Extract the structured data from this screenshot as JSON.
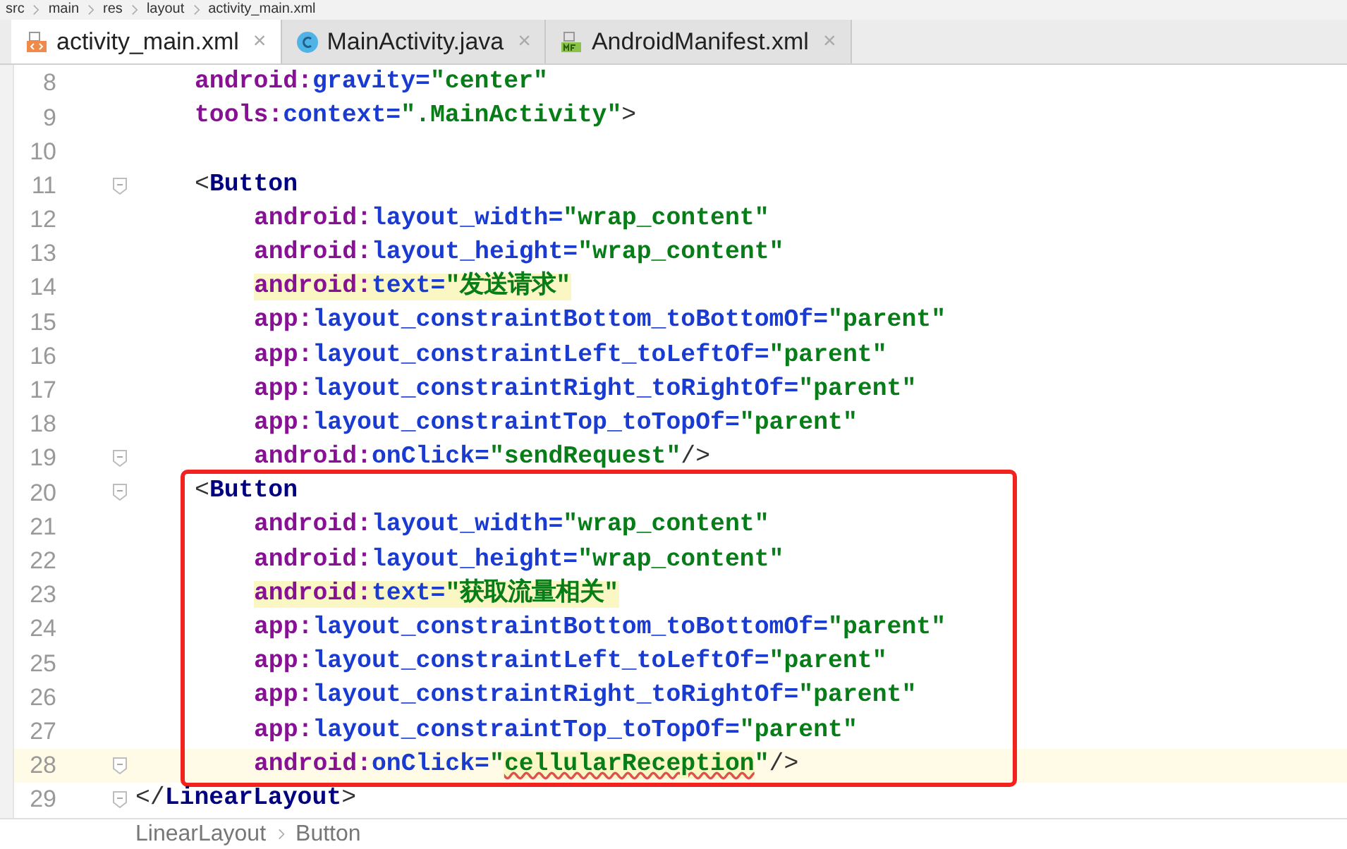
{
  "breadcrumb": [
    "src",
    "main",
    "res",
    "layout",
    "activity_main.xml"
  ],
  "tabs": [
    {
      "label": "activity_main.xml",
      "kind": "xml",
      "selected": true,
      "close": "×"
    },
    {
      "label": "MainActivity.java",
      "kind": "class",
      "selected": false,
      "close": "×"
    },
    {
      "label": "AndroidManifest.xml",
      "kind": "manifest",
      "selected": false,
      "close": "×"
    }
  ],
  "editor": {
    "blocks": [
      {
        "lines": [
          {
            "number": "8",
            "kind": "outer-attr",
            "tokens": [
              {
                "kind": "ns",
                "text": "android:"
              },
              {
                "kind": "attr",
                "text": "gravity="
              },
              {
                "kind": "str",
                "text": "\"center\""
              }
            ]
          },
          {
            "number": "9",
            "kind": "outer-attr",
            "tokens": [
              {
                "kind": "ns",
                "text": "tools:"
              },
              {
                "kind": "attr",
                "text": "context="
              },
              {
                "kind": "str",
                "text": "\".MainActivity\""
              },
              {
                "kind": "punct",
                "text": ">"
              }
            ]
          },
          {
            "number": "10"
          },
          {
            "number": "11",
            "kind": "element",
            "fold": true,
            "tokens": [
              {
                "kind": "punct",
                "text": "<"
              },
              {
                "kind": "tag",
                "text": "Button"
              }
            ]
          },
          {
            "number": "12",
            "kind": "attr",
            "tokens": [
              {
                "kind": "ns",
                "text": "android:"
              },
              {
                "kind": "attr",
                "text": "layout_width="
              },
              {
                "kind": "str",
                "text": "\"wrap_content\""
              }
            ]
          },
          {
            "number": "13",
            "kind": "attr",
            "tokens": [
              {
                "kind": "ns",
                "text": "android:"
              },
              {
                "kind": "attr",
                "text": "layout_height="
              },
              {
                "kind": "str",
                "text": "\"wrap_content\""
              }
            ]
          },
          {
            "number": "14",
            "kind": "attr",
            "tokens": [
              {
                "kind": "ns",
                "text": "android:",
                "marked": true
              },
              {
                "kind": "attr",
                "text": "text=",
                "marked": true
              },
              {
                "kind": "str",
                "text": "\"发送请求\"",
                "marked": true
              }
            ]
          },
          {
            "number": "15",
            "kind": "attr",
            "tokens": [
              {
                "kind": "ns",
                "text": "app:"
              },
              {
                "kind": "attr",
                "text": "layout_constraintBottom_toBottomOf="
              },
              {
                "kind": "str",
                "text": "\"parent\""
              }
            ]
          },
          {
            "number": "16",
            "kind": "attr",
            "tokens": [
              {
                "kind": "ns",
                "text": "app:"
              },
              {
                "kind": "attr",
                "text": "layout_constraintLeft_toLeftOf="
              },
              {
                "kind": "str",
                "text": "\"parent\""
              }
            ]
          },
          {
            "number": "17",
            "kind": "attr",
            "tokens": [
              {
                "kind": "ns",
                "text": "app:"
              },
              {
                "kind": "attr",
                "text": "layout_constraintRight_toRightOf="
              },
              {
                "kind": "str",
                "text": "\"parent\""
              }
            ]
          },
          {
            "number": "18",
            "kind": "attr",
            "tokens": [
              {
                "kind": "ns",
                "text": "app:"
              },
              {
                "kind": "attr",
                "text": "layout_constraintTop_toTopOf="
              },
              {
                "kind": "str",
                "text": "\"parent\""
              }
            ]
          },
          {
            "number": "19",
            "kind": "attr",
            "fold": true,
            "tokens": [
              {
                "kind": "ns",
                "text": "android:"
              },
              {
                "kind": "attr",
                "text": "onClick="
              },
              {
                "kind": "str",
                "text": "\"sendRequest\""
              },
              {
                "kind": "punct",
                "text": "/>"
              }
            ]
          }
        ]
      },
      {
        "boxed": true,
        "lines": [
          {
            "number": "20",
            "kind": "element",
            "fold": true,
            "tokens": [
              {
                "kind": "punct",
                "text": "<"
              },
              {
                "kind": "tag",
                "text": "Button"
              }
            ]
          },
          {
            "number": "21",
            "kind": "attr",
            "tokens": [
              {
                "kind": "ns",
                "text": "android:"
              },
              {
                "kind": "attr",
                "text": "layout_width="
              },
              {
                "kind": "str",
                "text": "\"wrap_content\""
              }
            ]
          },
          {
            "number": "22",
            "kind": "attr",
            "tokens": [
              {
                "kind": "ns",
                "text": "android:"
              },
              {
                "kind": "attr",
                "text": "layout_height="
              },
              {
                "kind": "str",
                "text": "\"wrap_content\""
              }
            ]
          },
          {
            "number": "23",
            "kind": "attr",
            "tokens": [
              {
                "kind": "ns",
                "text": "android:",
                "marked": true
              },
              {
                "kind": "attr",
                "text": "text=",
                "marked": true
              },
              {
                "kind": "str",
                "text": "\"获取流量相关\"",
                "marked": true
              }
            ]
          },
          {
            "number": "24",
            "kind": "attr",
            "tokens": [
              {
                "kind": "ns",
                "text": "app:"
              },
              {
                "kind": "attr",
                "text": "layout_constraintBottom_toBottomOf="
              },
              {
                "kind": "str",
                "text": "\"parent\""
              }
            ]
          },
          {
            "number": "25",
            "kind": "attr",
            "tokens": [
              {
                "kind": "ns",
                "text": "app:"
              },
              {
                "kind": "attr",
                "text": "layout_constraintLeft_toLeftOf="
              },
              {
                "kind": "str",
                "text": "\"parent\""
              }
            ]
          },
          {
            "number": "26",
            "kind": "attr",
            "tokens": [
              {
                "kind": "ns",
                "text": "app:"
              },
              {
                "kind": "attr",
                "text": "layout_constraintRight_toRightOf="
              },
              {
                "kind": "str",
                "text": "\"parent\""
              }
            ]
          },
          {
            "number": "27",
            "kind": "attr",
            "tokens": [
              {
                "kind": "ns",
                "text": "app:"
              },
              {
                "kind": "attr",
                "text": "layout_constraintTop_toTopOf="
              },
              {
                "kind": "str",
                "text": "\"parent\""
              }
            ]
          },
          {
            "number": "28",
            "kind": "attr",
            "fold": true,
            "current": true,
            "tokens": [
              {
                "kind": "ns",
                "text": "android:"
              },
              {
                "kind": "attr",
                "text": "onClick="
              },
              {
                "kind": "str",
                "text": "\""
              },
              {
                "kind": "str",
                "text": "cellularReception",
                "squiggle": true,
                "marked": true
              },
              {
                "kind": "str",
                "text": "\""
              },
              {
                "kind": "punct",
                "text": "/>"
              }
            ]
          }
        ]
      },
      {
        "lines": [
          {
            "number": "29",
            "kind": "end-tag",
            "fold": true,
            "tokens": [
              {
                "kind": "punct",
                "text": "</"
              },
              {
                "kind": "tag",
                "text": "LinearLayout"
              },
              {
                "kind": "punct",
                "text": ">"
              }
            ]
          }
        ]
      }
    ]
  },
  "structure_path": [
    "LinearLayout",
    "Button"
  ]
}
